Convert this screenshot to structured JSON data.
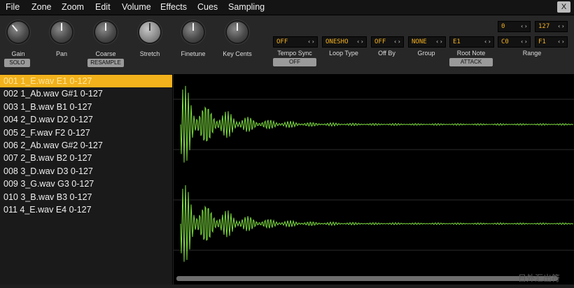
{
  "menubar": {
    "items": [
      "File",
      "Zone",
      "Zoom",
      "Edit",
      "Volume",
      "Effects",
      "Cues",
      "Sampling"
    ],
    "close_label": "X"
  },
  "knobs": [
    {
      "label": "Gain"
    },
    {
      "label": "Pan"
    },
    {
      "label": "Coarse"
    },
    {
      "label": "Stretch"
    },
    {
      "label": "Finetune"
    },
    {
      "label": "Key Cents"
    }
  ],
  "buttons": {
    "solo": "SOLO",
    "resample": "RESAMPLE",
    "tempo_off": "OFF",
    "attack": "ATTACK"
  },
  "selectors": {
    "tempo_sync": {
      "label": "Tempo Sync",
      "value": "OFF"
    },
    "loop_type": {
      "label": "Loop Type",
      "value": "ONESHO"
    },
    "off_by": {
      "label": "Off By",
      "value": "OFF"
    },
    "group": {
      "label": "Group",
      "value": "NONE"
    },
    "root_note": {
      "label": "Root Note",
      "value": "E1"
    },
    "range": {
      "label": "Range",
      "vel_low": "0",
      "vel_high": "127",
      "key_low": "C0",
      "key_high": "F1"
    }
  },
  "zones": [
    "001 1_E.wav E1 0-127",
    "002 1_Ab.wav G#1 0-127",
    "003 1_B.wav B1 0-127",
    "004 2_D.wav D2 0-127",
    "005 2_F.wav F2 0-127",
    "006 2_Ab.wav G#2 0-127",
    "007 2_B.wav B2 0-127",
    "008 3_D.wav D3 0-127",
    "009 3_G.wav G3 0-127",
    "010 3_B.wav B3 0-127",
    "011 4_E.wav E4 0-127"
  ],
  "selected_zone": 0,
  "arrows": "‹ ›",
  "watermark": "日外汇出符",
  "colors": {
    "accent": "#f2b21c",
    "lcd_text": "#f2b020",
    "waveform": "#7fe040"
  },
  "icons": {
    "knob": "rotary-knob-icon",
    "arrows": "left-right-arrows-icon"
  }
}
